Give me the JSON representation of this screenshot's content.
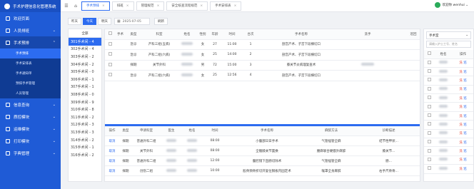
{
  "app": {
    "title": "手术护理信息化管理系统"
  },
  "sidebar": {
    "items": [
      {
        "label": "欢迎页面",
        "icon": "home-icon"
      },
      {
        "label": "人员排班",
        "icon": "people-icon"
      },
      {
        "label": "手术预排",
        "icon": "calendar-icon"
      }
    ],
    "submenu": [
      "手术预排",
      "手术安排表",
      "手术通知单",
      "预排手术管理",
      "人员管理"
    ],
    "items_after": [
      {
        "label": "信息查询",
        "icon": "search-icon"
      },
      {
        "label": "质控模块",
        "icon": "check-icon"
      },
      {
        "label": "运维模块",
        "icon": "tool-icon"
      },
      {
        "label": "打印模块",
        "icon": "printer-icon"
      },
      {
        "label": "字典管理",
        "icon": "book-icon"
      }
    ]
  },
  "tabs": [
    "手术预排",
    "排班",
    "管理规范",
    "安全核查流程规范",
    "手术安排表"
  ],
  "user": {
    "label": "欢迎你 wenhui"
  },
  "toolbar": {
    "yesterday": "昨天",
    "today": "今天",
    "tomorrow": "明天",
    "date": "2025-07-05",
    "refresh": "刷新"
  },
  "rooms": {
    "header": "全部",
    "list": [
      "301手术间 - 4",
      "302手术间 - 4",
      "303手术间 - 2",
      "304手术间 - 2",
      "305手术间 - 0",
      "306手术间 - 1",
      "307手术间 - 1",
      "308手术间 - 0",
      "309手术间 - 9",
      "310手术间 - 8",
      "311手术间 - 2",
      "312手术间 - 3",
      "313手术间 - 3",
      "314手术间 - 2",
      "315手术间 - 1",
      "316手术间 - 2"
    ]
  },
  "upper_table": {
    "headers": [
      "",
      "手术",
      "类型",
      "科室",
      "姓名",
      "性别",
      "年龄",
      "时间",
      "台次",
      "手术名称",
      "洗手",
      "巡回"
    ],
    "rows": [
      {
        "type": "急诊",
        "dept": "产科三组(五病)",
        "sex": "女",
        "age": "27",
        "time": "11:00",
        "seq": "1",
        "op": "剖宫产术、子宫下段横切口"
      },
      {
        "type": "急诊",
        "dept": "产科二组(六病)",
        "sex": "女",
        "age": "25",
        "time": "14:00",
        "seq": "2",
        "op": "剖宫产术、子宫下段横切口"
      },
      {
        "type": "择期",
        "dept": "关节外科",
        "sex": "男",
        "age": "72",
        "time": "15:00",
        "seq": "3",
        "op": "膝关节炎病理复查术"
      },
      {
        "type": "急诊",
        "dept": "产科二组(六病)",
        "sex": "女",
        "age": "25",
        "time": "12:56",
        "seq": "4",
        "op": "剖宫产术、子宫下段横切口"
      }
    ]
  },
  "lower_table": {
    "headers": [
      "操作",
      "类型",
      "申请科室",
      "医生",
      "姓名",
      "时间",
      "手术名称",
      "麻醉方法",
      "诊断描述"
    ],
    "rows": [
      {
        "action": "取消",
        "type": "择期",
        "dept": "普通外科二组",
        "time": "08:00",
        "op": "小腹部日日手术",
        "anes": "气管插管全麻",
        "diag": "结节性甲状..."
      },
      {
        "action": "取消",
        "type": "择期",
        "dept": "关节外科",
        "time": "08:00",
        "op": "全髋膝关节置换",
        "anes": "腰麻联合硬膜外麻醉",
        "diag": "膝关节..."
      },
      {
        "action": "取消",
        "type": "择期",
        "dept": "普通外科二组",
        "time": "12:00",
        "op": "腹腔镜下直肠切除术",
        "anes": "气管插管全麻",
        "diag": "肠..."
      },
      {
        "action": "取消",
        "type": "择期",
        "dept": "创伤二组",
        "time": "10:00",
        "op": "股骨颈骨折切开复位钢板内固定术",
        "anes": "喉罩全身麻醉",
        "diag": "右手尺骨骨..."
      }
    ]
  },
  "right_panel": {
    "select": "手术室",
    "search_placeholder": "请输入护士工号、姓名",
    "headers": [
      "",
      "姓名",
      "操作"
    ],
    "rows": [
      {
        "a": "洗",
        "b": "巡"
      },
      {
        "a": "洗",
        "b": "巡"
      },
      {
        "a": "洗",
        "b": "巡"
      },
      {
        "a": "洗",
        "b": "巡"
      },
      {
        "a": "洗",
        "b": "巡"
      },
      {
        "a": "洗",
        "b": "巡"
      },
      {
        "a": "洗",
        "b": "巡"
      },
      {
        "a": "洗",
        "b": "巡"
      },
      {
        "a": "洗",
        "b": "巡"
      },
      {
        "a": "洗",
        "b": "巡"
      },
      {
        "a": "洗",
        "b": "巡"
      },
      {
        "a": "洗",
        "b": "巡"
      },
      {
        "a": "洗",
        "b": "巡"
      }
    ]
  }
}
